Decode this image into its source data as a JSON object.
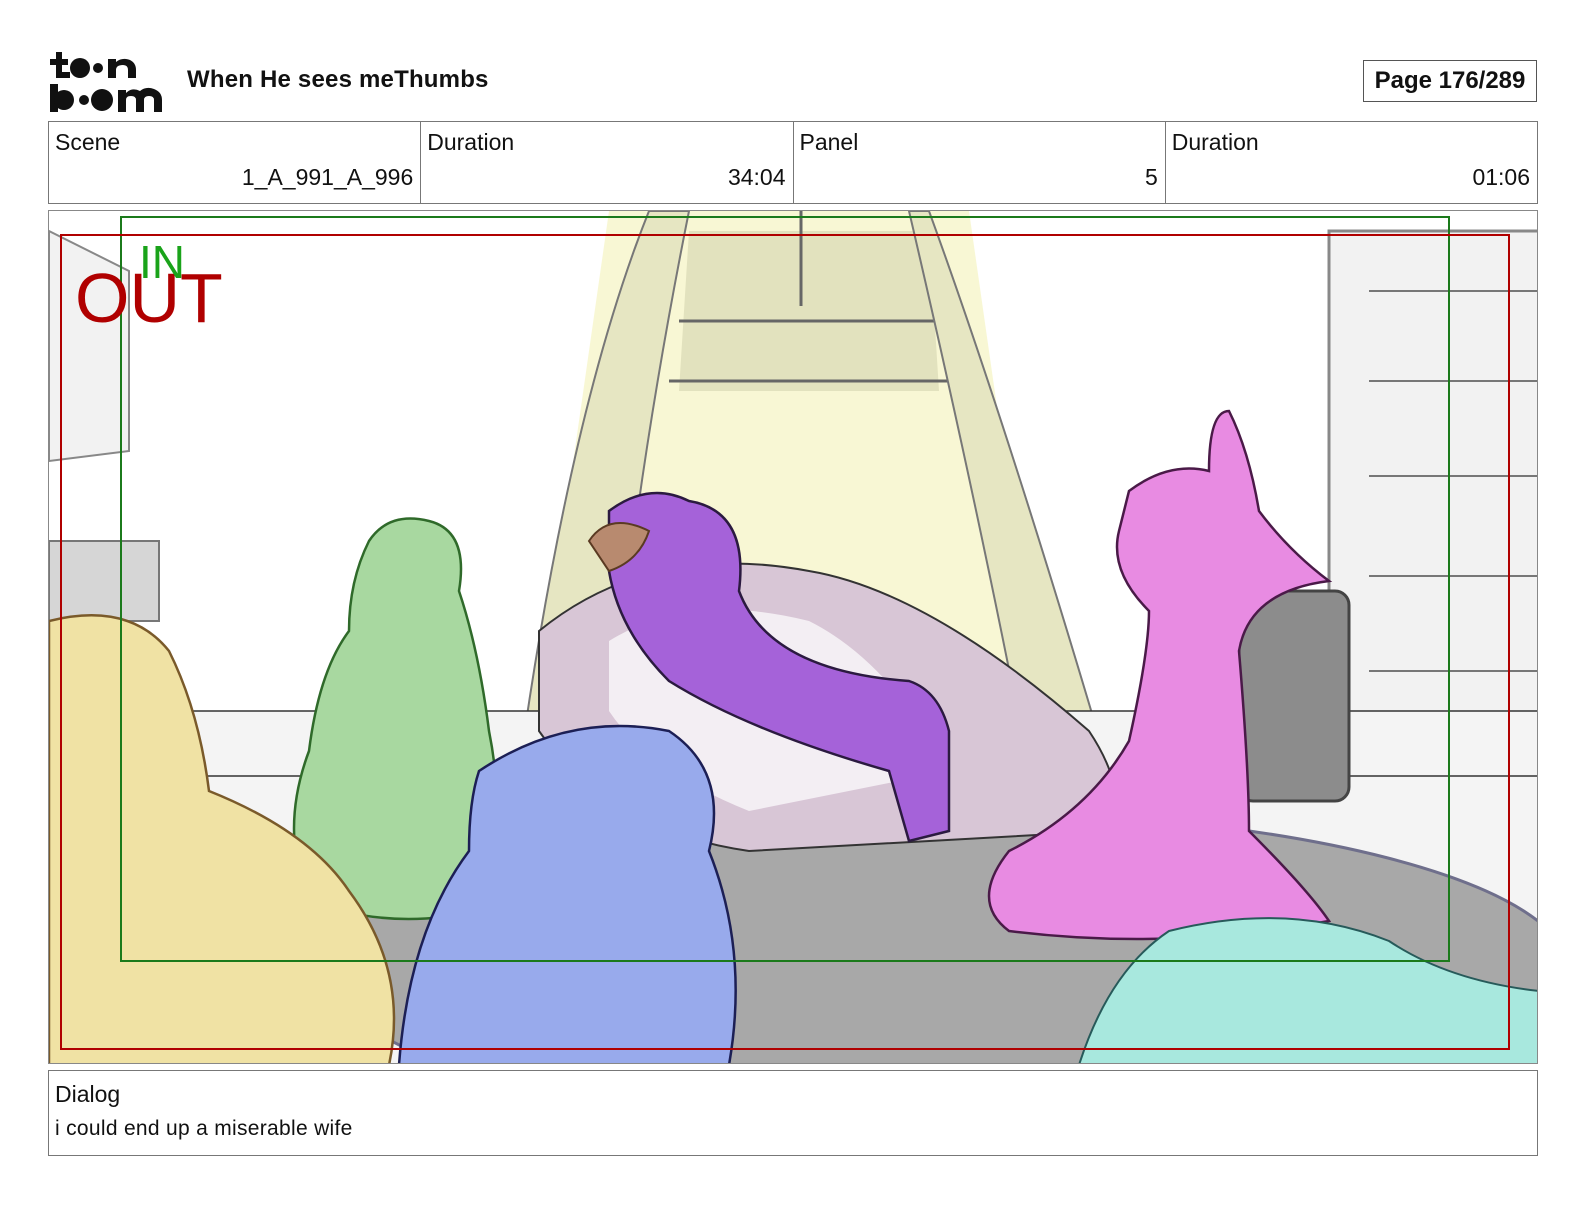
{
  "header": {
    "logo_text": "toon boom",
    "title": "When He sees meThumbs",
    "page": "Page 176/289"
  },
  "info": {
    "scene_label": "Scene",
    "scene_value": "1_A_991_A_996",
    "duration_label": "Duration",
    "duration_value": "34:04",
    "panel_label": "Panel",
    "panel_value": "5",
    "panel_duration_label": "Duration",
    "panel_duration_value": "01:06"
  },
  "frame": {
    "in_label": "IN",
    "out_label": "OUT",
    "in_color": "#1aa31a",
    "out_color": "#b00000"
  },
  "dialog": {
    "label": "Dialog",
    "text": "i could end up a miserable wife"
  }
}
